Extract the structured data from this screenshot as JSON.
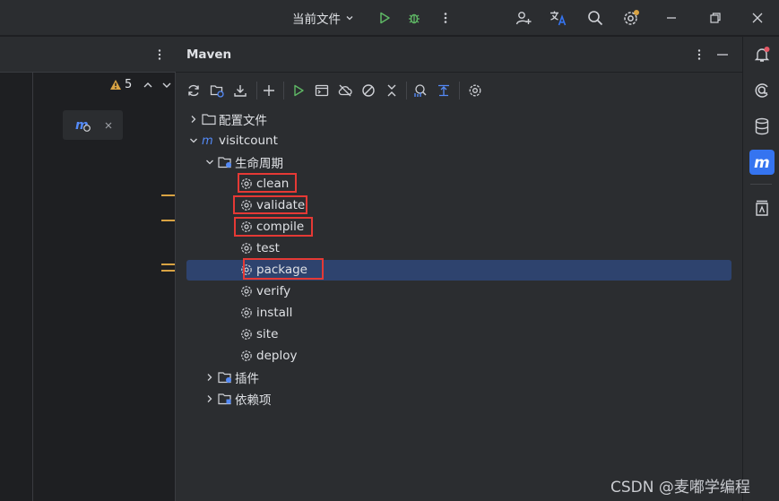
{
  "titlebar": {
    "run_config": "当前文件"
  },
  "editor": {
    "warning_count": "5"
  },
  "maven": {
    "title": "Maven",
    "tree": {
      "config_files": "配置文件",
      "project": "visitcount",
      "lifecycle": "生命周期",
      "phases": [
        "clean",
        "validate",
        "compile",
        "test",
        "package",
        "verify",
        "install",
        "site",
        "deploy"
      ],
      "plugins": "插件",
      "dependencies": "依赖项"
    },
    "selected_phase": "package",
    "highlighted_phases": [
      "clean",
      "validate",
      "compile",
      "package"
    ]
  },
  "watermark": "CSDN @麦嘟学编程",
  "colors": {
    "accent": "#3574f0",
    "run_green": "#5fb865",
    "highlight_red": "#e53935",
    "selection": "#2e436e",
    "warning": "#d9a343"
  }
}
